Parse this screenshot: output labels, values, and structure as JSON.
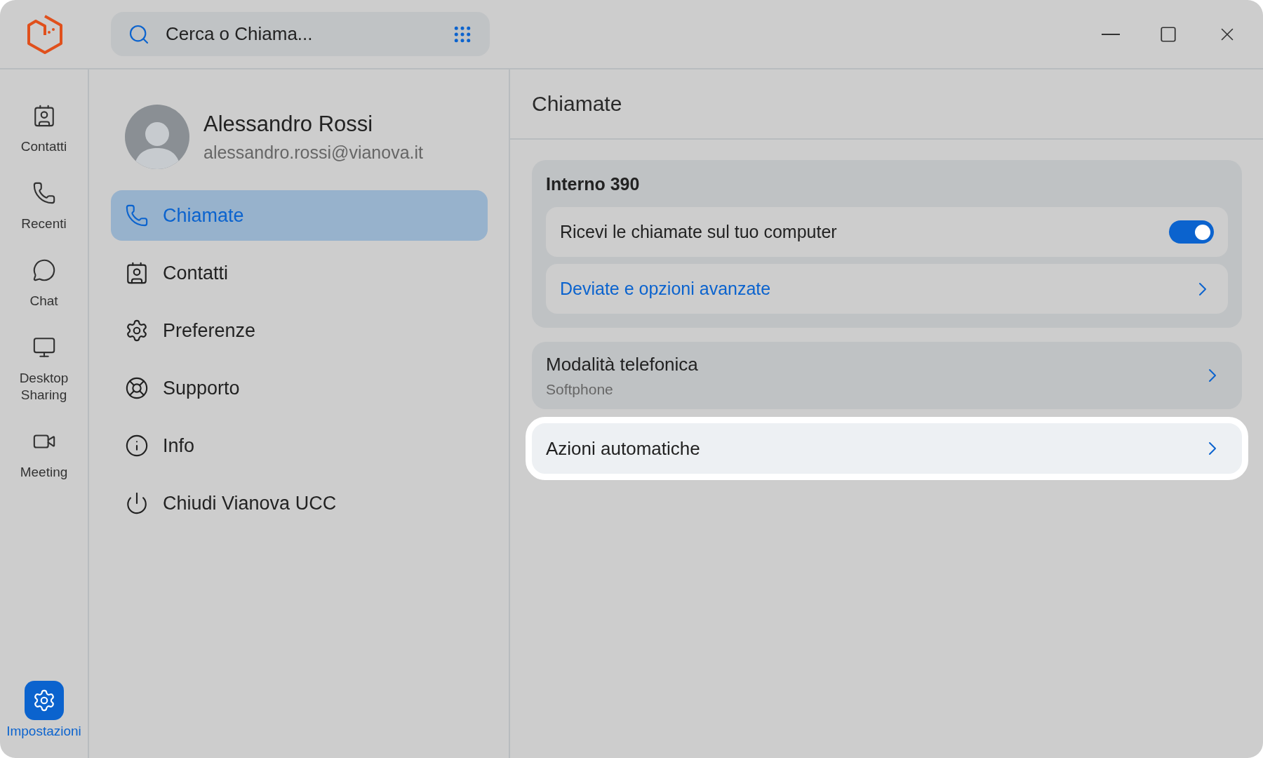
{
  "search": {
    "placeholder": "Cerca o Chiama..."
  },
  "rail": [
    {
      "label": "Contatti",
      "selected": false
    },
    {
      "label": "Recenti",
      "selected": false
    },
    {
      "label": "Chat",
      "selected": false
    },
    {
      "label": "Desktop Sharing",
      "selected": false
    },
    {
      "label": "Meeting",
      "selected": false
    }
  ],
  "rail_bottom": {
    "label": "Impostazioni",
    "selected": true
  },
  "profile": {
    "name": "Alessandro Rossi",
    "email": "alessandro.rossi@vianova.it"
  },
  "menu": [
    {
      "label": "Chiamate",
      "selected": true
    },
    {
      "label": "Contatti",
      "selected": false
    },
    {
      "label": "Preferenze",
      "selected": false
    },
    {
      "label": "Supporto",
      "selected": false
    },
    {
      "label": "Info",
      "selected": false
    },
    {
      "label": "Chiudi Vianova UCC",
      "selected": false
    }
  ],
  "page": {
    "title": "Chiamate",
    "extension": {
      "title": "Interno 390",
      "rows": [
        {
          "kind": "toggle",
          "label": "Ricevi le chiamate sul tuo computer",
          "on": true
        },
        {
          "kind": "link",
          "label": "Deviate e opzioni avanzate"
        }
      ]
    },
    "cards": [
      {
        "title": "Modalità telefonica",
        "subtitle": "Softphone",
        "highlighted": false
      },
      {
        "title": "Azioni automatiche",
        "highlighted": true
      }
    ]
  }
}
